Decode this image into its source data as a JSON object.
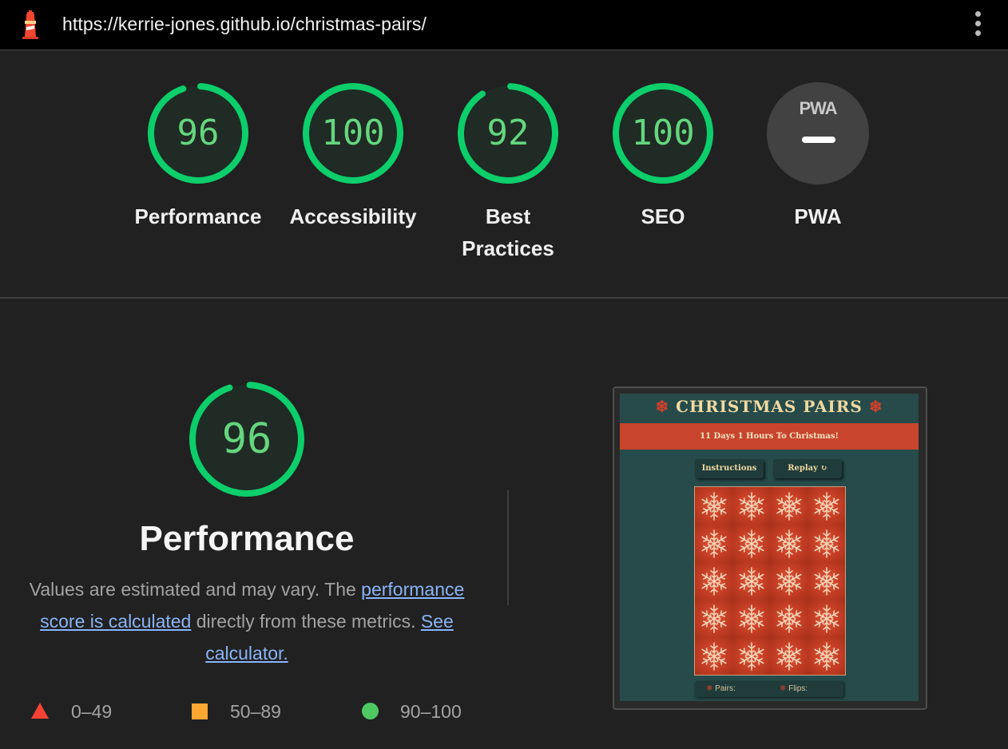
{
  "topbar": {
    "url": "https://kerrie-jones.github.io/christmas-pairs/",
    "logo_icon": "lighthouse-icon",
    "menu_icon": "kebab-menu-icon"
  },
  "gauges": [
    {
      "score": "96",
      "label": "Performance",
      "value": 96
    },
    {
      "score": "100",
      "label": "Accessibility",
      "value": 100
    },
    {
      "score": "92",
      "label": "Best Practices",
      "label_line1": "Best",
      "label_line2": "Practices",
      "value": 92
    },
    {
      "score": "100",
      "label": "SEO",
      "value": 100
    },
    {
      "score": "PWA",
      "label": "PWA",
      "value": null
    }
  ],
  "performance": {
    "score": "96",
    "value": 96,
    "title": "Performance",
    "desc_prefix": "Values are estimated and may vary. The ",
    "link_score": "performance score is calculated",
    "desc_middle": " directly from these metrics. ",
    "link_calc": "See calculator."
  },
  "legend": {
    "poor": "0–49",
    "average": "50–89",
    "good": "90–100"
  },
  "screenshot": {
    "title": "CHRISTMAS PAIRS",
    "countdown": "11 Days 1 Hours To Christmas!",
    "instructions_btn": "Instructions",
    "replay_btn": "Replay ↻",
    "pairs_label": "Pairs:",
    "flips_label": "Flips:",
    "grid_rows": 5,
    "grid_cols": 4
  },
  "colors": {
    "pass": "#0cce6b",
    "score_text": "#64d67e",
    "average": "#ffa733",
    "fail": "#f44336",
    "link": "#8ab4f8",
    "background": "#212121"
  }
}
